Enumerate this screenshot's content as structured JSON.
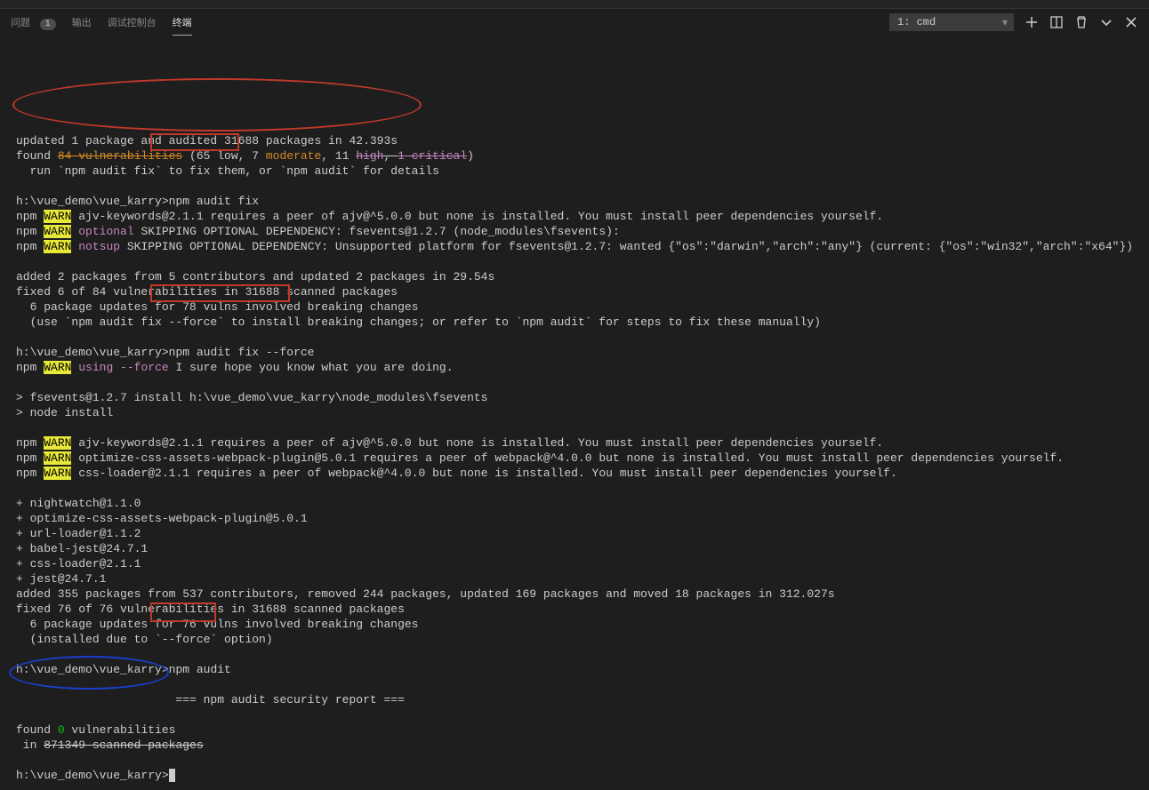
{
  "tabs": {
    "problems": "问题",
    "problems_badge": "1",
    "output": "输出",
    "debug": "调试控制台",
    "terminal": "终端"
  },
  "terminal_selector": "1: cmd",
  "lines": {
    "l1": "updated 1 package and audited 31688 packages in 42.393s",
    "l2a": "found ",
    "l2b": "84 vulnerabilities",
    "l2c": " (65 low, 7 ",
    "l2d": "moderate",
    "l2e": ", 11 ",
    "l2f": "high",
    "l2g": ", ",
    "l2h": "1 critical",
    "l2i": ")",
    "l3": "  run `npm audit fix` to fix them, or `npm audit` for details",
    "l5": "h:\\vue_demo\\vue_karry>",
    "l5b": "npm audit fix",
    "l6a": "npm ",
    "l6w": "WARN",
    "l6b": " ajv-keywords@2.1.1 requires a peer of ajv@^5.0.0 but none is installed. You must install peer dependencies yourself.",
    "l7a": "npm ",
    "l7b": " ",
    "l7c": "optional",
    "l7d": " SKIPPING OPTIONAL DEPENDENCY: fsevents@1.2.7 (node_modules\\fsevents):",
    "l8a": "npm ",
    "l8b": " ",
    "l8c": "notsup",
    "l8d": " SKIPPING OPTIONAL DEPENDENCY: Unsupported platform for fsevents@1.2.7: wanted {\"os\":\"darwin\",\"arch\":\"any\"} (current: {\"os\":\"win32\",\"arch\":\"x64\"})",
    "l10": "added 2 packages from 5 contributors and updated 2 packages in 29.54s",
    "l11": "fixed 6 of 84 vulnerabilities in 31688 scanned packages",
    "l12": "  6 package updates for 78 vulns involved breaking changes",
    "l13": "  (use `npm audit fix --force` to install breaking changes; or refer to `npm audit` for steps to fix these manually)",
    "l15": "h:\\vue_demo\\vue_karry>",
    "l15b": "npm audit fix --force",
    "l16a": "npm ",
    "l16b": " ",
    "l16c": "using --force",
    "l16d": " I sure hope you know what you are doing.",
    "l18": "> fsevents@1.2.7 install h:\\vue_demo\\vue_karry\\node_modules\\fsevents",
    "l19": "> node install",
    "l21a": "npm ",
    "l21b": " ajv-keywords@2.1.1 requires a peer of ajv@^5.0.0 but none is installed. You must install peer dependencies yourself.",
    "l22a": "npm ",
    "l22b": " optimize-css-assets-webpack-plugin@5.0.1 requires a peer of webpack@^4.0.0 but none is installed. You must install peer dependencies yourself.",
    "l23a": "npm ",
    "l23b": " css-loader@2.1.1 requires a peer of webpack@^4.0.0 but none is installed. You must install peer dependencies yourself.",
    "l25": "+ nightwatch@1.1.0",
    "l26": "+ optimize-css-assets-webpack-plugin@5.0.1",
    "l27": "+ url-loader@1.1.2",
    "l28": "+ babel-jest@24.7.1",
    "l29": "+ css-loader@2.1.1",
    "l30": "+ jest@24.7.1",
    "l31": "added 355 packages from 537 contributors, removed 244 packages, updated 169 packages and moved 18 packages in 312.027s",
    "l32": "fixed 76 of 76 vulnerabilities in 31688 scanned packages",
    "l33": "  6 package updates for 76 vulns involved breaking changes",
    "l34": "  (installed due to `--force` option)",
    "l36": "h:\\vue_demo\\vue_karry>",
    "l36b": "npm audit",
    "l38": "                       === npm audit security report ===",
    "l40a": "found ",
    "l40b": "0",
    "l40c": " vulnerabilities",
    "l41a": " in ",
    "l41b": "871349 scanned packages",
    "l43": "h:\\vue_demo\\vue_karry>"
  }
}
